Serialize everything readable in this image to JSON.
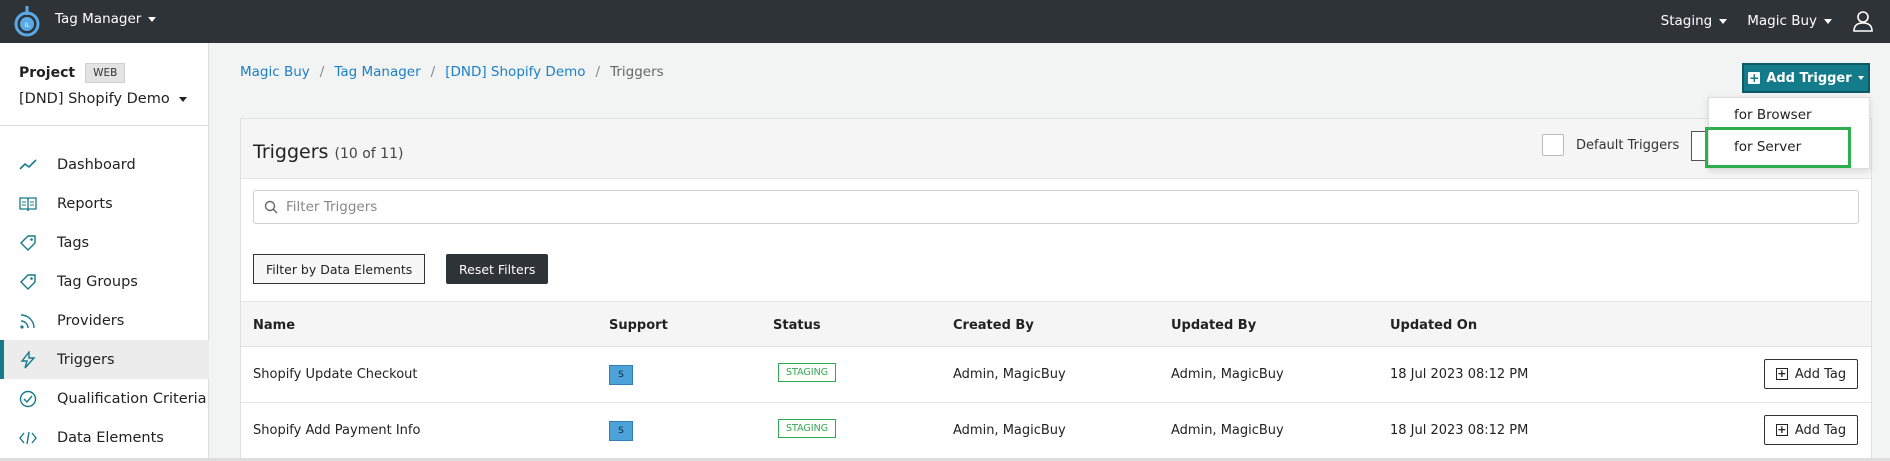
{
  "topbar": {
    "app_title": "Tag Manager",
    "env_label": "Staging",
    "account_label": "Magic Buy"
  },
  "sidebar": {
    "project_label": "Project",
    "project_type": "WEB",
    "project_name": "[DND] Shopify Demo",
    "items": [
      {
        "label": "Dashboard",
        "icon": "chart-line-icon"
      },
      {
        "label": "Reports",
        "icon": "book-icon"
      },
      {
        "label": "Tags",
        "icon": "tag-icon"
      },
      {
        "label": "Tag Groups",
        "icon": "tags-icon"
      },
      {
        "label": "Providers",
        "icon": "rss-icon"
      },
      {
        "label": "Triggers",
        "icon": "bolt-icon",
        "active": true
      },
      {
        "label": "Qualification Criteria",
        "icon": "check-circle-icon"
      },
      {
        "label": "Data Elements",
        "icon": "code-icon"
      }
    ]
  },
  "breadcrumb": {
    "items": [
      "Magic Buy",
      "Tag Manager",
      "[DND] Shopify Demo"
    ],
    "current": "Triggers",
    "separator": "/"
  },
  "add_trigger": {
    "label": "Add Trigger",
    "menu": [
      "for Browser",
      "for Server"
    ]
  },
  "card": {
    "title": "Triggers",
    "count": "(10 of 11)",
    "default_triggers_label": "Default Triggers",
    "filter_placeholder": "Filter Triggers",
    "filter_by_data_elements": "Filter by Data Elements",
    "reset_filters": "Reset Filters"
  },
  "table": {
    "columns": [
      "Name",
      "Support",
      "Status",
      "Created By",
      "Updated By",
      "Updated On"
    ],
    "rows": [
      {
        "name": "Shopify Update Checkout",
        "support": "S",
        "status": "STAGING",
        "created_by": "Admin, MagicBuy",
        "updated_by": "Admin, MagicBuy",
        "updated_on": "18 Jul 2023 08:12 PM",
        "action": "Add Tag"
      },
      {
        "name": "Shopify Add Payment Info",
        "support": "S",
        "status": "STAGING",
        "created_by": "Admin, MagicBuy",
        "updated_by": "Admin, MagicBuy",
        "updated_on": "18 Jul 2023 08:12 PM",
        "action": "Add Tag"
      }
    ]
  },
  "colors": {
    "topbar": "#2e3338",
    "accent": "#147b8a",
    "link": "#1c7fc4",
    "status_green": "#2fa84f",
    "highlight": "#2fae4e"
  }
}
